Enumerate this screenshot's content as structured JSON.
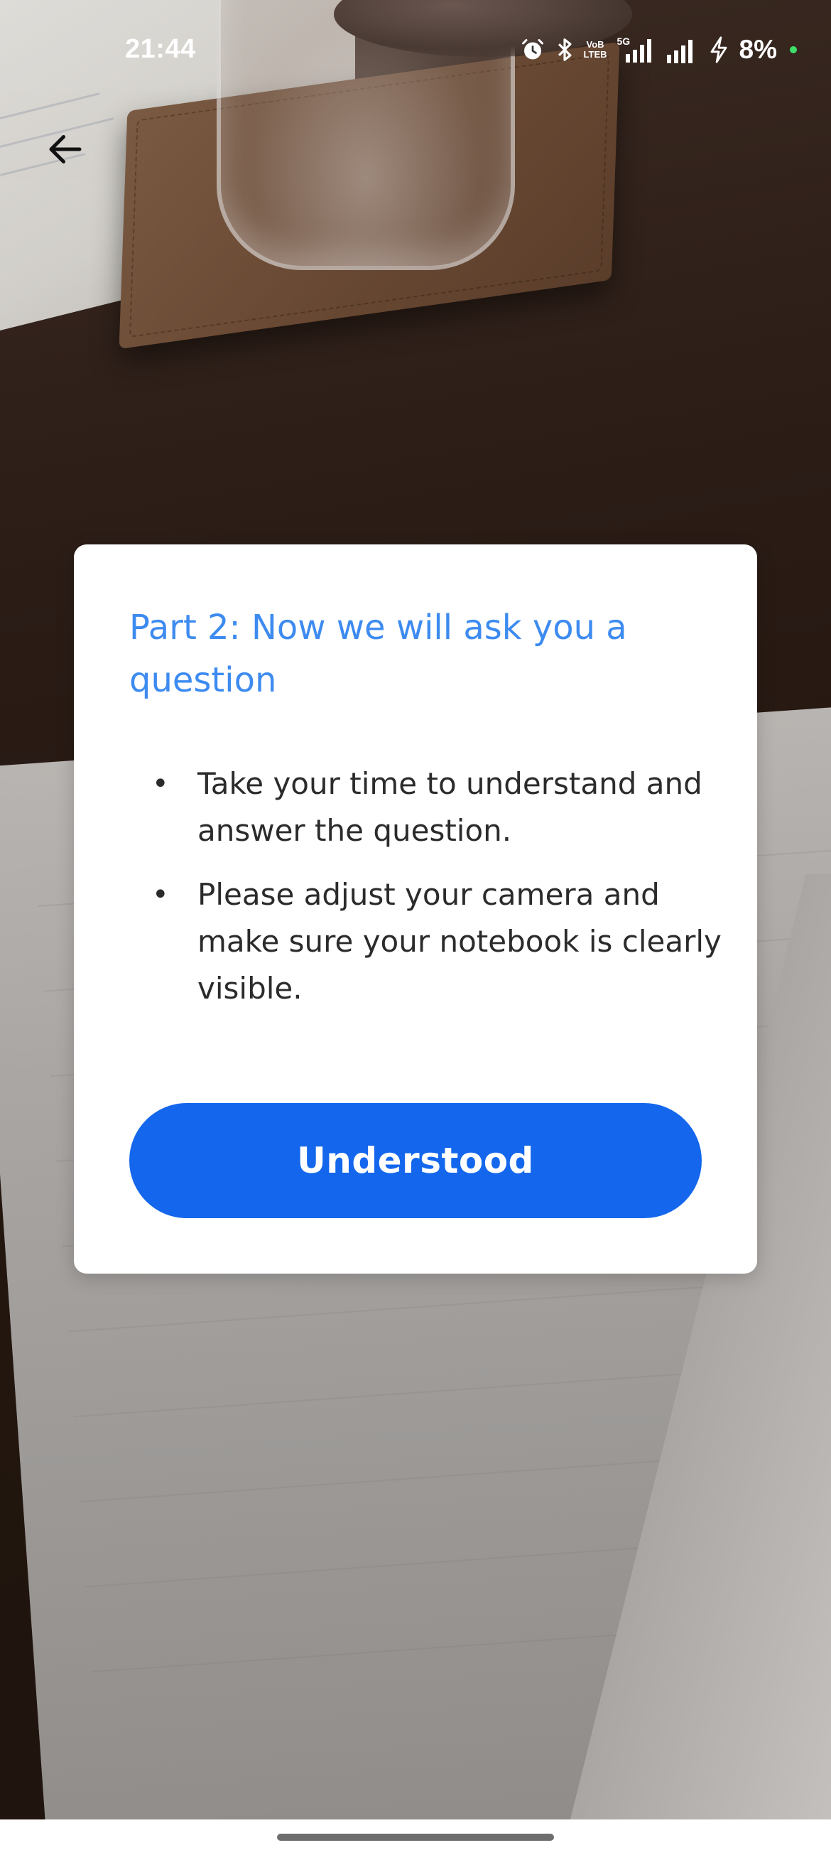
{
  "status_bar": {
    "time": "21:44",
    "battery_percent": "8%",
    "network_label_1": "VoB",
    "network_label_2": "LTEB",
    "network_5g": "5G",
    "icons": [
      "alarm-icon",
      "bluetooth-icon",
      "volte-icon",
      "signal-5g-icon",
      "signal-icon",
      "charging-icon",
      "privacy-dot-icon"
    ],
    "dot_color": "#3ee06a"
  },
  "navigation": {
    "back_icon": "arrow-left-icon"
  },
  "dialog": {
    "title": "Part 2: Now we will ask you a question",
    "items": [
      {
        "text": "Take your time to understand and answer the question."
      },
      {
        "text": "Please adjust your camera and make sure your notebook is clearly visible."
      }
    ],
    "button_label": "Understood"
  },
  "colors": {
    "title": "#3d8bf0",
    "button": "#1467ec",
    "dialog_bg": "#ffffff",
    "body_text": "#2b2b2b"
  }
}
